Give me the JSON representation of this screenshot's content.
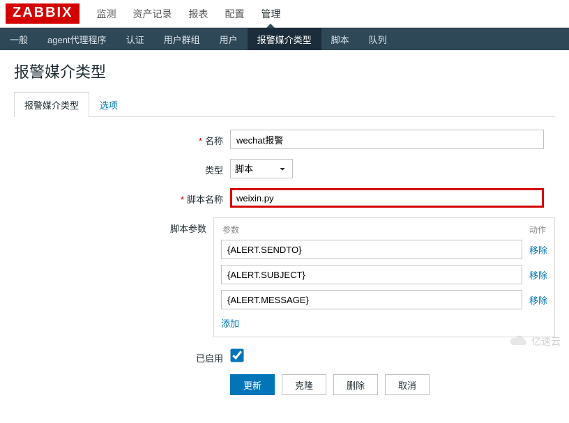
{
  "logo": "ZABBIX",
  "topnav": {
    "items": [
      {
        "label": "监测"
      },
      {
        "label": "资产记录"
      },
      {
        "label": "报表"
      },
      {
        "label": "配置"
      },
      {
        "label": "管理",
        "active": true
      }
    ]
  },
  "subnav": {
    "items": [
      {
        "label": "一般"
      },
      {
        "label": "agent代理程序"
      },
      {
        "label": "认证"
      },
      {
        "label": "用户群组"
      },
      {
        "label": "用户"
      },
      {
        "label": "报警媒介类型",
        "active": true
      },
      {
        "label": "脚本"
      },
      {
        "label": "队列"
      }
    ]
  },
  "page_title": "报警媒介类型",
  "tabs": [
    {
      "label": "报警媒介类型",
      "active": true
    },
    {
      "label": "选项"
    }
  ],
  "form": {
    "name_label": "名称",
    "name_value": "wechat报警",
    "type_label": "类型",
    "type_value": "脚本",
    "script_name_label": "脚本名称",
    "script_name_value": "weixin.py",
    "params_label": "脚本参数",
    "params_header_param": "参数",
    "params_header_action": "动作",
    "params": [
      {
        "value": "{ALERT.SENDTO}"
      },
      {
        "value": "{ALERT.SUBJECT}"
      },
      {
        "value": "{ALERT.MESSAGE}"
      }
    ],
    "remove_label": "移除",
    "add_label": "添加",
    "enabled_label": "已启用",
    "enabled_checked": true
  },
  "buttons": {
    "update": "更新",
    "clone": "克隆",
    "delete": "删除",
    "cancel": "取消"
  },
  "watermark": "亿速云"
}
